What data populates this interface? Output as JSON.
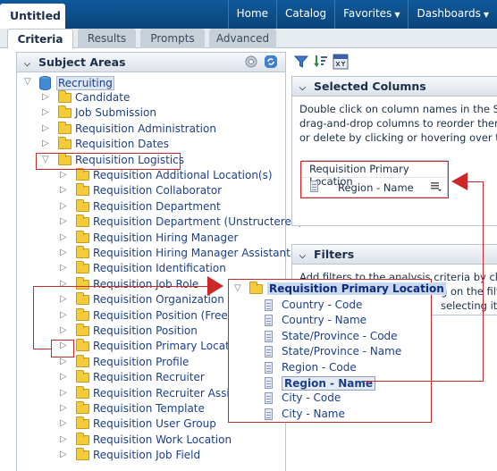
{
  "window": {
    "doc_tab": "Untitled"
  },
  "topnav": [
    {
      "label": "Home",
      "caret": false
    },
    {
      "label": "Catalog",
      "caret": false
    },
    {
      "label": "Favorites",
      "caret": true
    },
    {
      "label": "Dashboards",
      "caret": true
    }
  ],
  "tabs": [
    "Criteria",
    "Results",
    "Prompts",
    "Advanced"
  ],
  "subject_areas": {
    "title": "Subject Areas",
    "root": "Recruiting",
    "top_items": [
      "Candidate",
      "Job Submission",
      "Requisition Administration",
      "Requisition Dates"
    ],
    "expanded": "Requisition Logistics",
    "children": [
      "Requisition Additional Location(s)",
      "Requisition Collaborator",
      "Requisition Department",
      "Requisition Department (Unstructered)",
      "Requisition Hiring Manager",
      "Requisition Hiring Manager Assistant",
      "Requisition Identification",
      "Requisition Job Role",
      "Requisition Organization",
      "Requisition Position (Free Te",
      "Requisition Position",
      "Requisition Primary Location",
      "Requisition Profile",
      "Requisition Recruiter",
      "Requisition Recruiter Assistan",
      "Requisition Template",
      "Requisition User Group",
      "Requisition Work Location",
      "Requisition Job Field"
    ]
  },
  "selected_columns": {
    "title": "Selected Columns",
    "instructions": [
      "Double click on column names in the Su",
      "drag-and-drop columns to reorder them",
      "or delete by clicking or hovering over th"
    ],
    "column_group": "Requisition Primary Location",
    "column_name": "Region - Name"
  },
  "filters": {
    "title": "Filters",
    "instructions": [
      "Add filters to the analysis criteria by clicki",
      "g on the filte",
      "selecting its"
    ]
  },
  "popup": {
    "title": "Requisition Primary Location",
    "columns": [
      "Country - Code",
      "Country - Name",
      "State/Province - Code",
      "State/Province - Name",
      "Region - Code",
      "Region - Name",
      "City - Code",
      "City - Name"
    ],
    "selected": "Region - Name"
  },
  "colors": {
    "topbar": "#0a4a86",
    "link_text": "#1c3f8a",
    "callout_red": "#cc2828",
    "folder": "#f4cc3b"
  }
}
